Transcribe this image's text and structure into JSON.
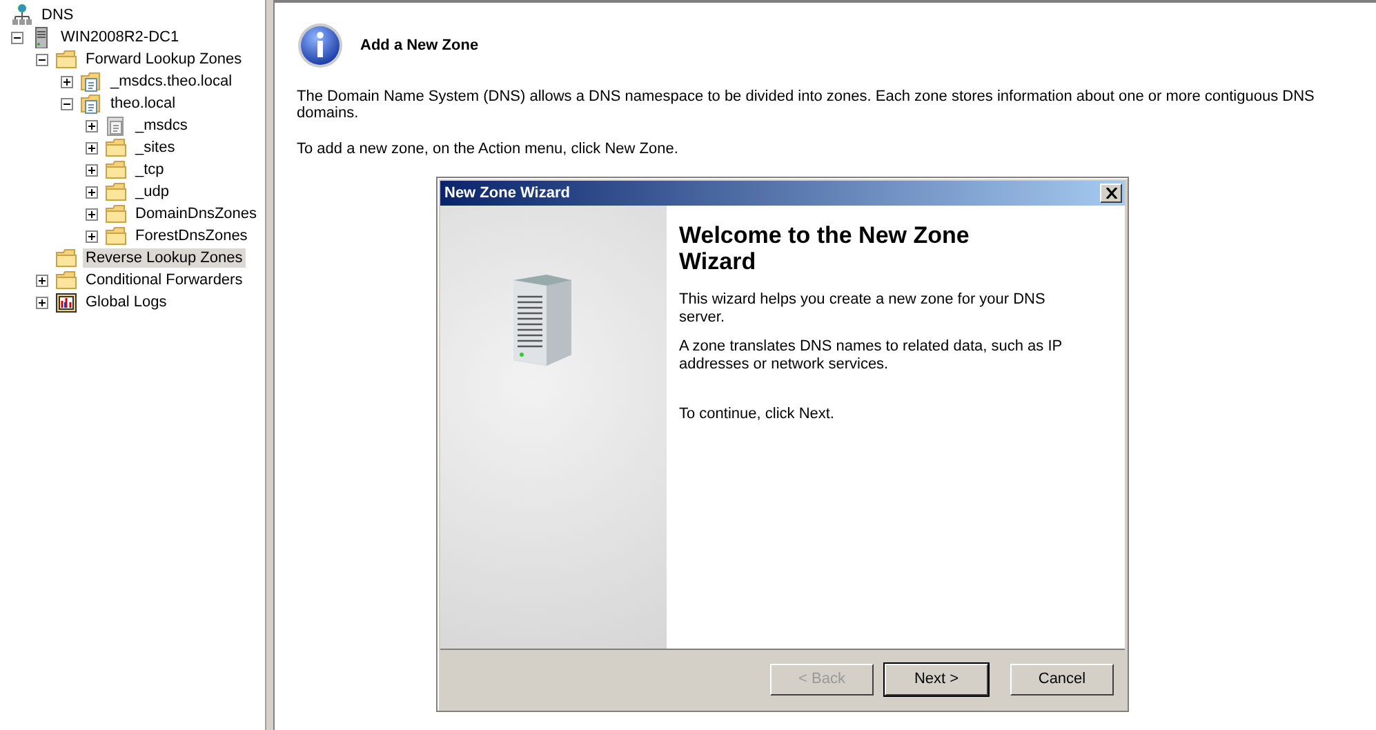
{
  "tree": [
    {
      "label": "DNS",
      "kind": "dns",
      "selected": false,
      "children": [
        {
          "label": "WIN2008R2-DC1",
          "kind": "server",
          "expanded": true,
          "selected": false,
          "children": [
            {
              "label": "Forward Lookup Zones",
              "kind": "folder",
              "expanded": true,
              "selected": false,
              "children": [
                {
                  "label": "_msdcs.theo.local",
                  "kind": "zone",
                  "expanded": false,
                  "selected": false
                },
                {
                  "label": "theo.local",
                  "kind": "zone",
                  "expanded": true,
                  "selected": false,
                  "children": [
                    {
                      "label": "_msdcs",
                      "kind": "zone-grey",
                      "expanded": false,
                      "selected": false
                    },
                    {
                      "label": "_sites",
                      "kind": "folder",
                      "expanded": false,
                      "selected": false
                    },
                    {
                      "label": "_tcp",
                      "kind": "folder",
                      "expanded": false,
                      "selected": false
                    },
                    {
                      "label": "_udp",
                      "kind": "folder",
                      "expanded": false,
                      "selected": false
                    },
                    {
                      "label": "DomainDnsZones",
                      "kind": "folder",
                      "expanded": false,
                      "selected": false
                    },
                    {
                      "label": "ForestDnsZones",
                      "kind": "folder",
                      "expanded": false,
                      "selected": false
                    }
                  ]
                }
              ]
            },
            {
              "label": "Reverse Lookup Zones",
              "kind": "folder",
              "selected": true
            },
            {
              "label": "Conditional Forwarders",
              "kind": "folder",
              "expanded": false,
              "selected": false
            },
            {
              "label": "Global Logs",
              "kind": "logs",
              "expanded": false,
              "selected": false
            }
          ]
        }
      ]
    }
  ],
  "info": {
    "heading": "Add a New Zone",
    "paragraphs": [
      "The Domain Name System (DNS) allows a DNS namespace to be divided into zones. Each zone stores information about one or more contiguous DNS domains.",
      "To add a new zone, on the Action menu, click New Zone."
    ]
  },
  "dialog": {
    "title": "New Zone Wizard",
    "heading": "Welcome to the New Zone Wizard",
    "paragraphs": [
      "This wizard helps you create a new zone for your DNS server.",
      "A zone translates DNS names to related data, such as IP addresses or network services.",
      "To continue, click Next."
    ],
    "buttons": [
      {
        "label": "< Back",
        "disabled": true,
        "default": false
      },
      {
        "label": "Next >",
        "disabled": false,
        "default": true
      },
      {
        "label": "Cancel",
        "disabled": false,
        "default": false
      }
    ]
  }
}
